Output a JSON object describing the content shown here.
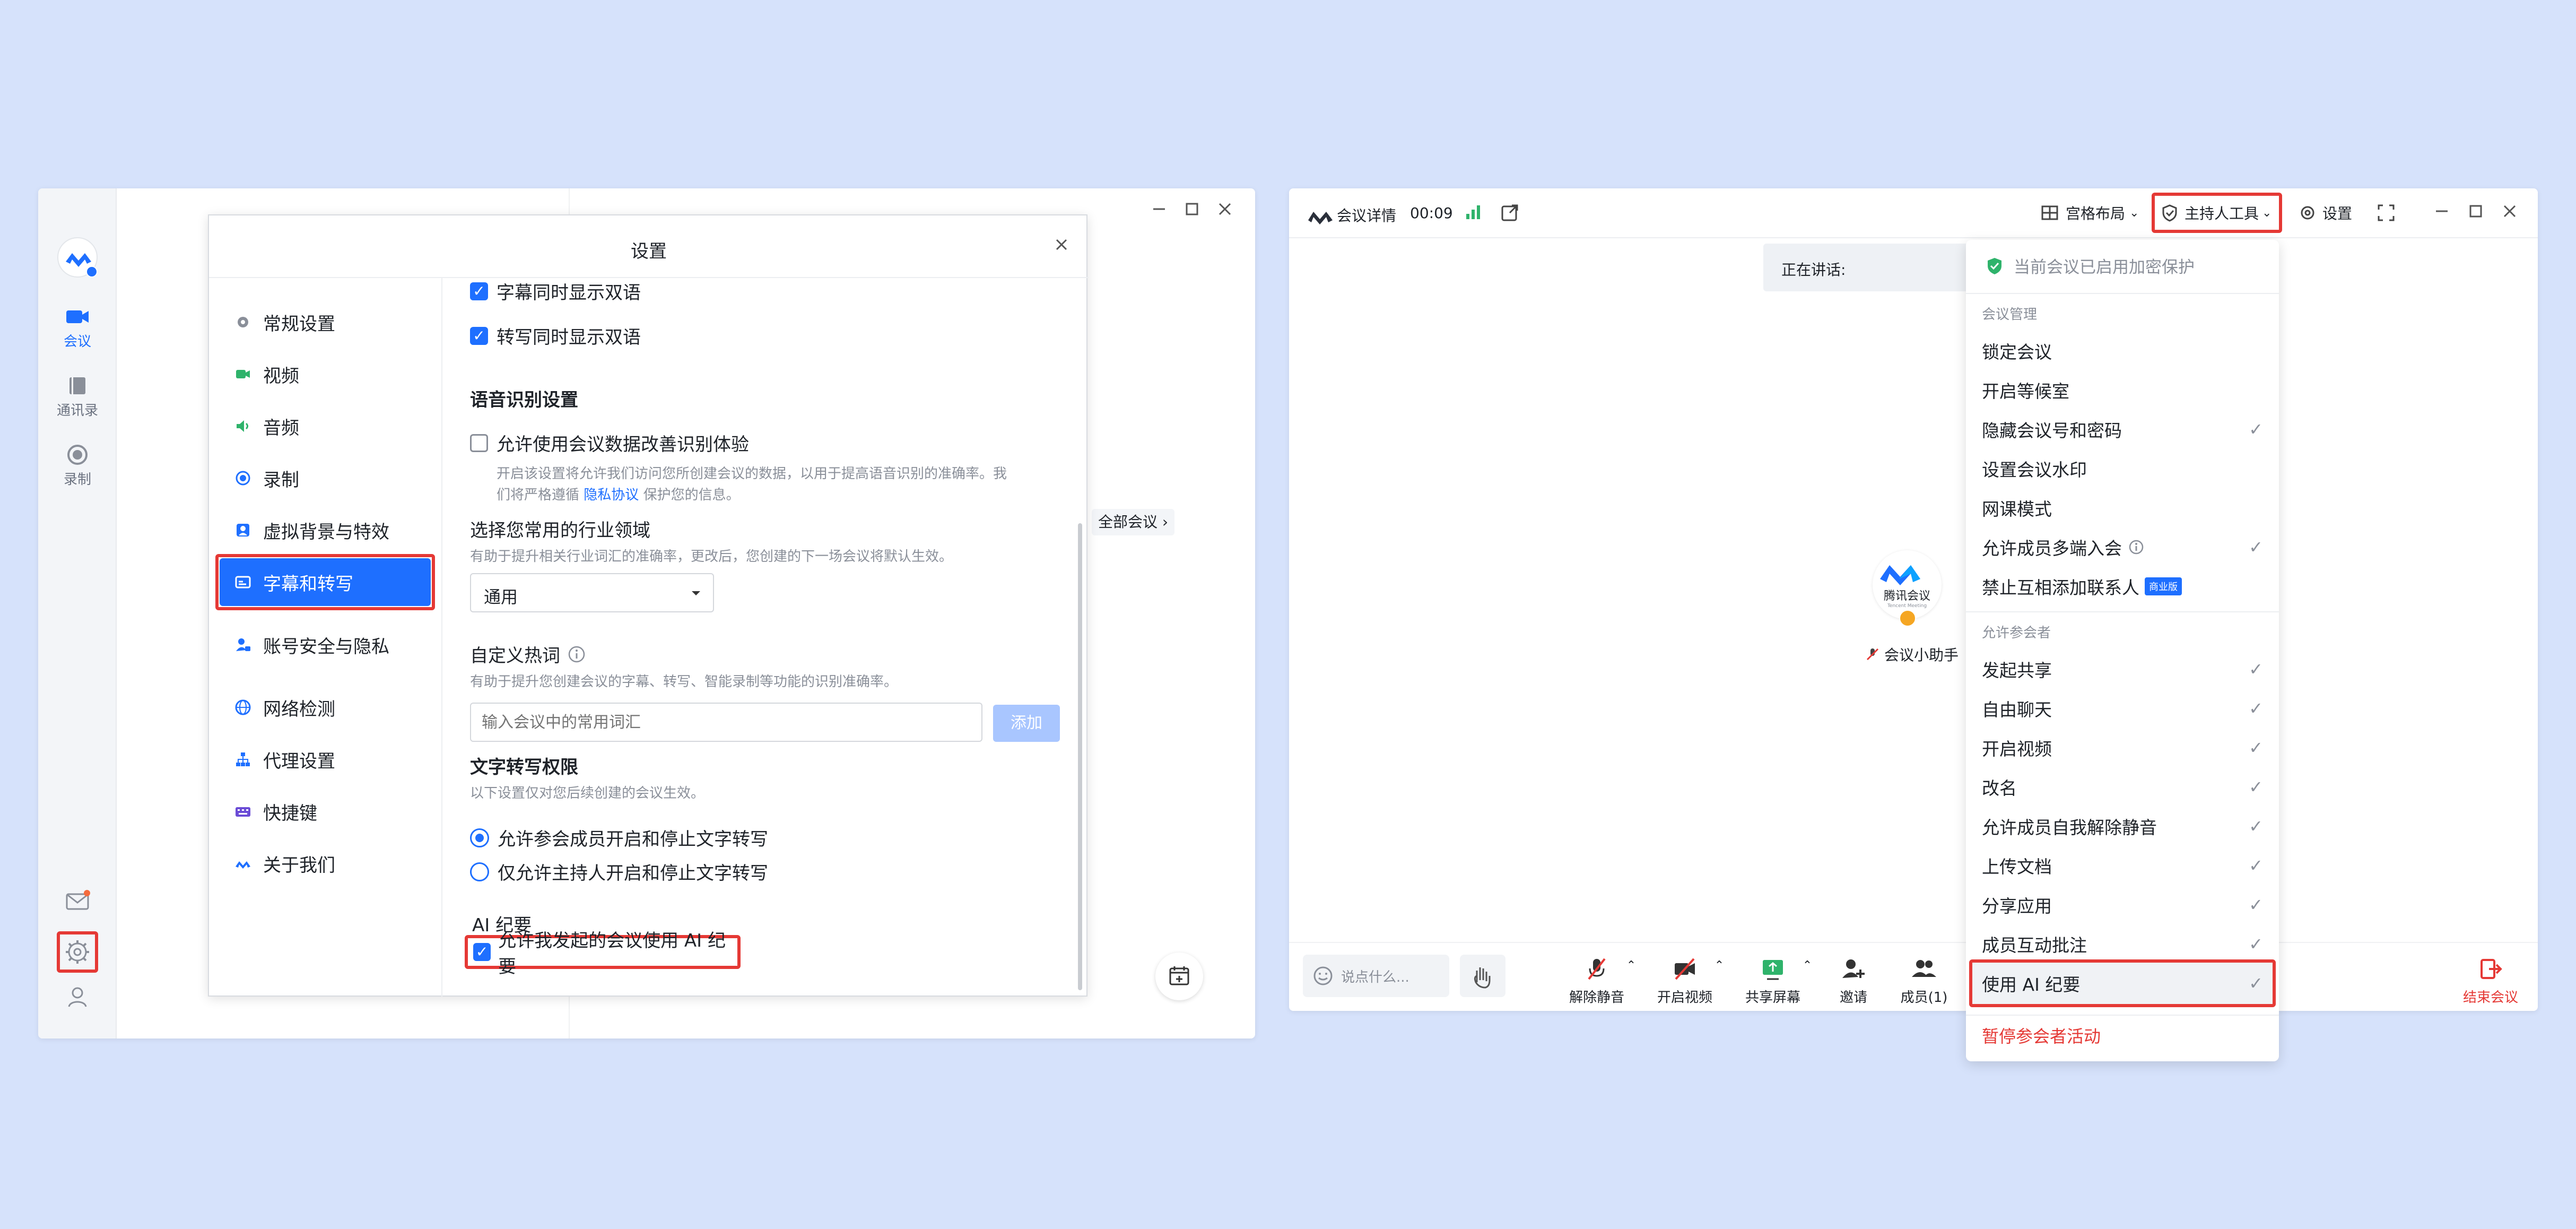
{
  "left_window": {
    "sidebar": {
      "items": [
        {
          "label": "会议",
          "icon": "video-camera-icon"
        },
        {
          "label": "通讯录",
          "icon": "contacts-book-icon"
        },
        {
          "label": "录制",
          "icon": "record-icon"
        }
      ],
      "bottom_icons": [
        "mail-icon",
        "gear-icon",
        "user-icon"
      ]
    },
    "behind_button": "全部会议",
    "settings_dialog": {
      "title": "设置",
      "nav": [
        {
          "label": "常规设置",
          "icon": "gear-icon"
        },
        {
          "label": "视频",
          "icon": "video-icon"
        },
        {
          "label": "音频",
          "icon": "speaker-icon"
        },
        {
          "label": "录制",
          "icon": "record-icon"
        },
        {
          "label": "虚拟背景与特效",
          "icon": "portrait-icon"
        },
        {
          "label": "字幕和转写",
          "icon": "subtitle-icon"
        },
        {
          "label": "账号安全与隐私",
          "icon": "account-lock-icon"
        },
        {
          "label": "网络检测",
          "icon": "globe-icon"
        },
        {
          "label": "代理设置",
          "icon": "network-icon"
        },
        {
          "label": "快捷键",
          "icon": "keyboard-icon"
        },
        {
          "label": "关于我们",
          "icon": "tencent-meeting-icon"
        }
      ],
      "content": {
        "cb_subtitle_bilingual": "字幕同时显示双语",
        "cb_transcript_bilingual": "转写同时显示双语",
        "speech_section_title": "语音识别设置",
        "cb_improve": "允许使用会议数据改善识别体验",
        "improve_desc_1": "开启该设置将允许我们访问您所创建会议的数据，以用于提高语音识别的准确率。我",
        "improve_desc_2_prefix": "们将严格遵循",
        "privacy_link": "隐私协议",
        "improve_desc_2_suffix": "保护您的信息。",
        "industry_title": "选择您常用的行业领域",
        "industry_desc": "有助于提升相关行业词汇的准确率，更改后，您创建的下一场会议将默认生效。",
        "industry_value": "通用",
        "hotword_title": "自定义热词",
        "hotword_desc": "有助于提升您创建会议的字幕、转写、智能录制等功能的识别准确率。",
        "hotword_placeholder": "输入会议中的常用词汇",
        "hotword_add": "添加",
        "permission_title": "文字转写权限",
        "permission_desc": "以下设置仅对您后续创建的会议生效。",
        "radio_all": "允许参会成员开启和停止文字转写",
        "radio_host": "仅允许主持人开启和停止文字转写",
        "ai_title": "AI 纪要",
        "cb_ai": "允许我发起的会议使用 AI 纪要"
      }
    }
  },
  "right_window": {
    "title_bar": {
      "meeting_detail": "会议详情",
      "timer": "00:09",
      "layout_btn": "宫格布局",
      "host_tools": "主持人工具",
      "settings": "设置"
    },
    "speaking_label": "正在讲话:",
    "participant": {
      "logo_text": "腾讯会议",
      "logo_sub": "Tencent Meeting",
      "name": "会议小助手"
    },
    "chat_placeholder": "说点什么...",
    "toolbar": [
      {
        "label": "解除静音",
        "icon": "mic-muted-icon"
      },
      {
        "label": "开启视频",
        "icon": "video-off-icon"
      },
      {
        "label": "共享屏幕",
        "icon": "share-screen-icon"
      },
      {
        "label": "邀请",
        "icon": "add-user-icon"
      },
      {
        "label": "成员(1)",
        "icon": "members-icon"
      }
    ],
    "end_meeting": "结束会议",
    "host_menu": {
      "encryption_notice": "当前会议已启用加密保护",
      "section_manage": "会议管理",
      "manage_items": [
        {
          "label": "锁定会议",
          "checked": false
        },
        {
          "label": "开启等候室",
          "checked": false
        },
        {
          "label": "隐藏会议号和密码",
          "checked": true
        },
        {
          "label": "设置会议水印",
          "checked": false
        },
        {
          "label": "网课模式",
          "checked": false
        },
        {
          "label": "允许成员多端入会",
          "checked": true
        },
        {
          "label": "禁止互相添加联系人",
          "checked": false
        }
      ],
      "business_badge": "商业版",
      "section_participants": "允许参会者",
      "participant_items": [
        {
          "label": "发起共享",
          "checked": true
        },
        {
          "label": "自由聊天",
          "checked": true
        },
        {
          "label": "开启视频",
          "checked": true
        },
        {
          "label": "改名",
          "checked": true
        },
        {
          "label": "允许成员自我解除静音",
          "checked": true
        },
        {
          "label": "上传文档",
          "checked": true
        },
        {
          "label": "分享应用",
          "checked": true
        },
        {
          "label": "成员互动批注",
          "checked": true
        },
        {
          "label": "使用 AI 纪要",
          "checked": true
        }
      ],
      "pause_activity": "暂停参会者活动"
    }
  },
  "colors": {
    "background": "#d6e2fb",
    "accent": "#1e6fff",
    "highlight": "#e53935",
    "danger": "#e53935"
  }
}
